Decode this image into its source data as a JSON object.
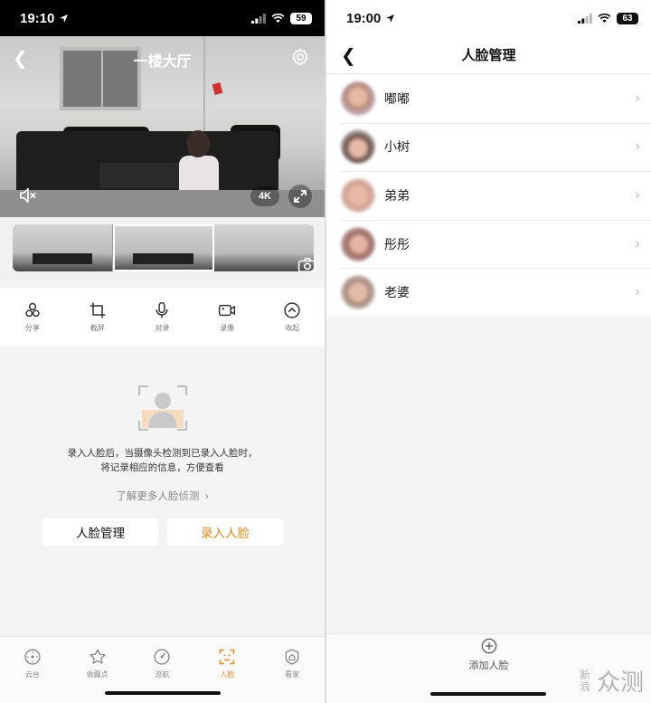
{
  "left_screen": {
    "status_bar": {
      "time": "19:10",
      "battery": "59"
    },
    "video": {
      "title": "一楼大厅",
      "resolution_badge": "4K"
    },
    "actions": [
      {
        "label": "分享",
        "icon": "share-icon"
      },
      {
        "label": "截屏",
        "icon": "crop-icon"
      },
      {
        "label": "对讲",
        "icon": "microphone-icon"
      },
      {
        "label": "录像",
        "icon": "video-record-icon"
      },
      {
        "label": "收起",
        "icon": "collapse-icon"
      }
    ],
    "face_empty_state": {
      "description_line1": "录入人脸后，当摄像头检测到已录入人脸时，",
      "description_line2": "将记录相应的信息，方便查看",
      "learn_more": "了解更多人脸侦测",
      "manage_button": "人脸管理",
      "record_button": "录入人脸"
    },
    "tab_bar": [
      {
        "label": "云台",
        "icon": "ptz-icon",
        "active": false
      },
      {
        "label": "收藏点",
        "icon": "star-icon",
        "active": false
      },
      {
        "label": "巡航",
        "icon": "cruise-icon",
        "active": false
      },
      {
        "label": "人脸",
        "icon": "face-scan-icon",
        "active": true
      },
      {
        "label": "看家",
        "icon": "home-guard-icon",
        "active": false
      }
    ],
    "accent_color": "#e08a23"
  },
  "right_screen": {
    "status_bar": {
      "time": "19:00",
      "battery": "63"
    },
    "nav": {
      "title": "人脸管理"
    },
    "faces": [
      {
        "name": "嘟嘟"
      },
      {
        "name": "小树"
      },
      {
        "name": "弟弟"
      },
      {
        "name": "彤彤"
      },
      {
        "name": "老婆"
      }
    ],
    "add_face_label": "添加人脸",
    "watermark": {
      "part1": "新浪",
      "part2": "众测"
    }
  }
}
